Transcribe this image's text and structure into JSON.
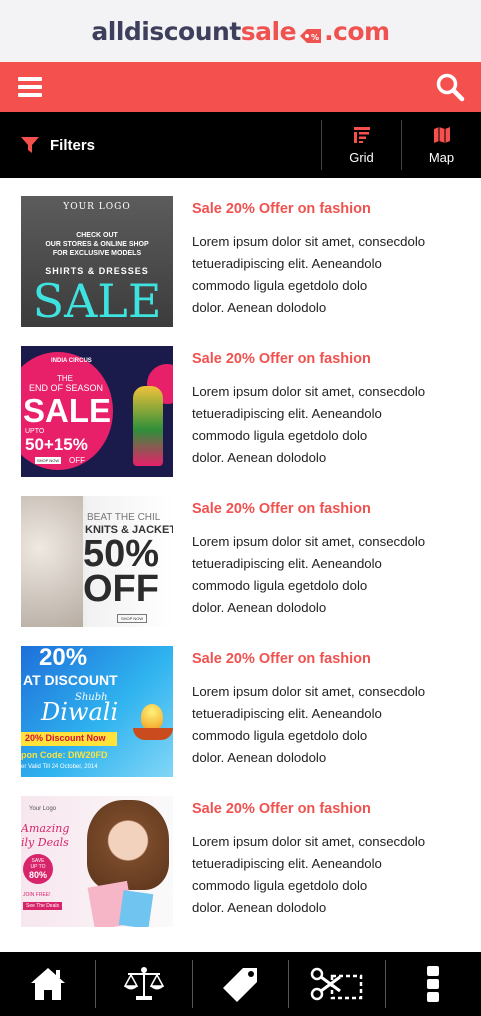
{
  "logo": {
    "part1": "alldiscount",
    "part2": "sale",
    "part3": ".com"
  },
  "header": {
    "menu_icon": "hamburger-icon",
    "search_icon": "search-icon"
  },
  "filterbar": {
    "filters_label": "Filters",
    "grid_label": "Grid",
    "map_label": "Map"
  },
  "colors": {
    "accent": "#f4514e",
    "logo_dark": "#3d3f5c",
    "bar": "#000000"
  },
  "items": [
    {
      "title": "Sale 20% Offer on fashion",
      "desc": [
        "Lorem ipsum dolor sit amet, consecdolo",
        "tetueradipiscing elit. Aeneandolo",
        "commodo ligula egetdolo dolo",
        "dolor. Aenean dolodolo"
      ],
      "thumb": {
        "line1": "YOUR LOGO",
        "line2": "CHECK OUT",
        "line3": "OUR STORES & ONLINE SHOP",
        "line4": "FOR EXCLUSIVE MODELS",
        "line5": "SHIRTS & DRESSES",
        "big": "SALE"
      }
    },
    {
      "title": "Sale 20% Offer on fashion",
      "desc": [
        "Lorem ipsum dolor sit amet, consecdolo",
        "tetueradipiscing elit. Aeneandolo",
        "commodo ligula egetdolo dolo",
        "dolor. Aenean dolodolo"
      ],
      "thumb": {
        "line1": "INDIA CIRCUS",
        "line2": "THE",
        "line3": "END OF SEASON",
        "big": "SALE",
        "line4": "UPTO",
        "line5": "50+15%",
        "line6": "OFF",
        "cta": "SHOP NOW"
      }
    },
    {
      "title": "Sale 20% Offer on fashion",
      "desc": [
        "Lorem ipsum dolor sit amet, consecdolo",
        "tetueradipiscing elit. Aeneandolo",
        "commodo ligula egetdolo dolo",
        "dolor. Aenean dolodolo"
      ],
      "thumb": {
        "line1": "BEAT THE CHIL",
        "line2": "KNITS & JACKET",
        "big1": "50%",
        "big2": "OFF",
        "cta": "SHOP NOW"
      }
    },
    {
      "title": "Sale 20% Offer on fashion",
      "desc": [
        "Lorem ipsum dolor sit amet, consecdolo",
        "tetueradipiscing elit. Aeneandolo",
        "commodo ligula egetdolo dolo",
        "dolor. Aenean dolodolo"
      ],
      "thumb": {
        "line1": "20%",
        "line2": "AT DISCOUNT",
        "line3": "Shubh",
        "line4": "Diwali",
        "line5": "20% Discount Now",
        "line6": "pon Code: DIW20FD",
        "line7": "er Valid Till 24 October, 2014"
      }
    },
    {
      "title": "Sale 20% Offer on fashion",
      "desc": [
        "Lorem ipsum dolor sit amet, consecdolo",
        "tetueradipiscing elit. Aeneandolo",
        "commodo ligula egetdolo dolo",
        "dolor. Aenean dolodolo"
      ],
      "thumb": {
        "line1": "Your Logo",
        "line2": "Amazing",
        "line3": "ily Deals",
        "line4": "SAVE",
        "line5": "UP TO",
        "line6": "80%",
        "line7": "JOIN FREE!",
        "line8": "See The Deals"
      }
    }
  ],
  "bottom_nav": [
    "home-icon",
    "scales-icon",
    "price-tag-icon",
    "coupon-scissors-icon",
    "more-vertical-icon"
  ]
}
